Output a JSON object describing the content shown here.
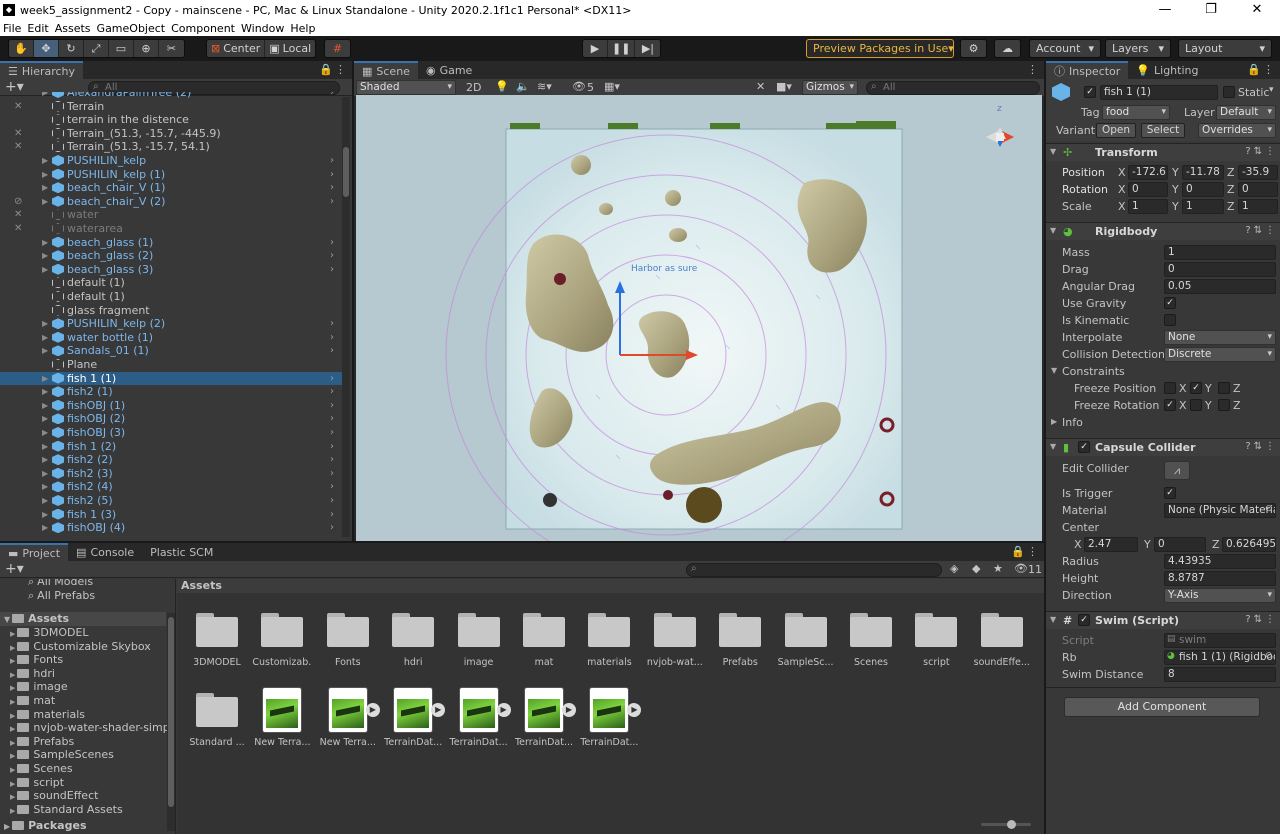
{
  "window": {
    "title": "week5_assignment2 - Copy - mainscene - PC, Mac & Linux Standalone - Unity 2020.2.1f1c1 Personal* <DX11>"
  },
  "menu": [
    "File",
    "Edit",
    "Assets",
    "GameObject",
    "Component",
    "Window",
    "Help"
  ],
  "toolbar": {
    "pivot": "Center",
    "space": "Local",
    "preview_packages": "Preview Packages in Use",
    "account": "Account",
    "layers": "Layers",
    "layout": "Layout"
  },
  "hierarchy": {
    "tab": "Hierarchy",
    "search_placeholder": "All",
    "items": [
      {
        "label": "AlexandraPalmTree (2)",
        "type": "prefab"
      },
      {
        "label": "Terrain",
        "type": "go"
      },
      {
        "label": "terrain in the distence",
        "type": "go"
      },
      {
        "label": "Terrain_(51.3, -15.7, -445.9)",
        "type": "go"
      },
      {
        "label": "Terrain_(51.3, -15.7, 54.1)",
        "type": "go"
      },
      {
        "label": "PUSHILIN_kelp",
        "type": "prefab"
      },
      {
        "label": "PUSHILIN_kelp (1)",
        "type": "prefab"
      },
      {
        "label": "beach_chair_V (1)",
        "type": "prefab"
      },
      {
        "label": "beach_chair_V (2)",
        "type": "prefab"
      },
      {
        "label": "water",
        "type": "inactive"
      },
      {
        "label": "waterarea",
        "type": "inactive"
      },
      {
        "label": "beach_glass (1)",
        "type": "prefab"
      },
      {
        "label": "beach_glass (2)",
        "type": "prefab"
      },
      {
        "label": "beach_glass (3)",
        "type": "prefab"
      },
      {
        "label": "default (1)",
        "type": "go"
      },
      {
        "label": "default (1)",
        "type": "go"
      },
      {
        "label": "glass fragment",
        "type": "go"
      },
      {
        "label": "PUSHILIN_kelp (2)",
        "type": "prefab"
      },
      {
        "label": "water bottle (1)",
        "type": "prefab"
      },
      {
        "label": "Sandals_01 (1)",
        "type": "prefab"
      },
      {
        "label": "Plane",
        "type": "go"
      },
      {
        "label": "fish 1 (1)",
        "type": "selected"
      },
      {
        "label": "fish2 (1)",
        "type": "prefab"
      },
      {
        "label": "fishOBJ (1)",
        "type": "prefab"
      },
      {
        "label": "fishOBJ (2)",
        "type": "prefab"
      },
      {
        "label": "fishOBJ (3)",
        "type": "prefab"
      },
      {
        "label": "fish 1 (2)",
        "type": "prefab"
      },
      {
        "label": "fish2 (2)",
        "type": "prefab"
      },
      {
        "label": "fish2 (3)",
        "type": "prefab"
      },
      {
        "label": "fish2 (4)",
        "type": "prefab"
      },
      {
        "label": "fish2 (5)",
        "type": "prefab"
      },
      {
        "label": "fish 1 (3)",
        "type": "prefab"
      },
      {
        "label": "fishOBJ (4)",
        "type": "prefab"
      }
    ]
  },
  "scene": {
    "tab_scene": "Scene",
    "tab_game": "Game",
    "shading": "Shaded",
    "mode_2d": "2D",
    "effects_count": "5",
    "gizmos": "Gizmos",
    "search_placeholder": "All",
    "axis_z": "z",
    "overlay_text": "Harbor as sure"
  },
  "project": {
    "tab_project": "Project",
    "tab_console": "Console",
    "tab_plastic": "Plastic SCM",
    "badge_count": "11",
    "breadcrumb": "Assets",
    "favorites": [
      "All Models",
      "All Prefabs"
    ],
    "tree_root": "Assets",
    "tree": [
      "3DMODEL",
      "Customizable Skybox",
      "Fonts",
      "hdri",
      "image",
      "mat",
      "materials",
      "nvjob-water-shader-simple",
      "Prefabs",
      "SampleScenes",
      "Scenes",
      "script",
      "soundEffect",
      "Standard Assets"
    ],
    "packages": "Packages",
    "assets_row1": [
      "3DMODEL",
      "Customizab...",
      "Fonts",
      "hdri",
      "image",
      "mat",
      "materials",
      "nvjob-wat...",
      "Prefabs",
      "SampleSc...",
      "Scenes",
      "script",
      "soundEffe..."
    ],
    "assets_row2": [
      {
        "label": "Standard ...",
        "kind": "folder"
      },
      {
        "label": "New Terra...",
        "kind": "terrain",
        "play": false
      },
      {
        "label": "New Terra...",
        "kind": "terrain",
        "play": true
      },
      {
        "label": "TerrainDat...",
        "kind": "terrain",
        "play": true
      },
      {
        "label": "TerrainDat...",
        "kind": "terrain",
        "play": true
      },
      {
        "label": "TerrainDat...",
        "kind": "terrain",
        "play": true
      },
      {
        "label": "TerrainDat...",
        "kind": "terrain",
        "play": true
      }
    ]
  },
  "inspector": {
    "tab_inspector": "Inspector",
    "tab_lighting": "Lighting",
    "object_name": "fish 1 (1)",
    "static_label": "Static",
    "tag_label": "Tag",
    "tag_value": "food",
    "layer_label": "Layer",
    "layer_value": "Default",
    "variant_label": "Variant",
    "open": "Open",
    "select": "Select",
    "overrides": "Overrides",
    "transform": {
      "title": "Transform",
      "position_label": "Position",
      "rotation_label": "Rotation",
      "scale_label": "Scale",
      "position": [
        "-172.6",
        "-11.78",
        "-35.9"
      ],
      "rotation": [
        "0",
        "0",
        "0"
      ],
      "scale": [
        "1",
        "1",
        "1"
      ]
    },
    "rigidbody": {
      "title": "Rigidbody",
      "mass_label": "Mass",
      "mass": "1",
      "drag_label": "Drag",
      "drag": "0",
      "angular_drag_label": "Angular Drag",
      "angular_drag": "0.05",
      "use_gravity_label": "Use Gravity",
      "is_kinematic_label": "Is Kinematic",
      "interpolate_label": "Interpolate",
      "interpolate": "None",
      "collision_label": "Collision Detection",
      "collision": "Discrete",
      "constraints_label": "Constraints",
      "freeze_pos_label": "Freeze Position",
      "freeze_rot_label": "Freeze Rotation",
      "info_label": "Info"
    },
    "capsule": {
      "title": "Capsule Collider",
      "edit_label": "Edit Collider",
      "trigger_label": "Is Trigger",
      "material_label": "Material",
      "material": "None (Physic Material)",
      "center_label": "Center",
      "center": [
        "2.47",
        "0",
        "0.6264954"
      ],
      "radius_label": "Radius",
      "radius": "4.43935",
      "height_label": "Height",
      "height": "8.8787",
      "direction_label": "Direction",
      "direction": "Y-Axis"
    },
    "swim": {
      "title": "Swim (Script)",
      "script_label": "Script",
      "script": "swim",
      "rb_label": "Rb",
      "rb": "fish 1 (1) (Rigidbody)",
      "distance_label": "Swim Distance",
      "distance": "8"
    },
    "add_component": "Add Component"
  }
}
